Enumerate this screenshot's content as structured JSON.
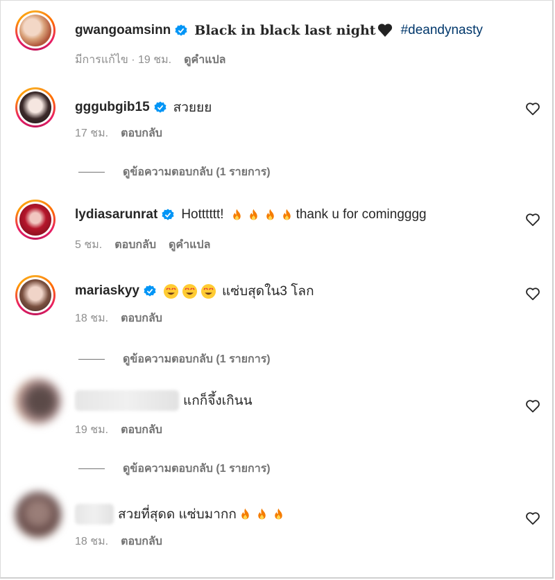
{
  "caption": {
    "username": "gwangoamsinn",
    "text": "Black in black last night",
    "hashtag": "#deandynasty",
    "edited": "มีการแก้ไข · 19 ชม.",
    "translate": "ดูคำแปล"
  },
  "comments": [
    {
      "username": "gggubgib15",
      "text": "สวยยย",
      "time": "17 ชม.",
      "reply": "ตอบกลับ",
      "view_replies": "ดูข้อความตอบกลับ (1 รายการ)"
    },
    {
      "username": "lydiasarunrat",
      "text_before": "Hotttttt!",
      "text_after": "thank u for comingggg",
      "time": "5 ชม.",
      "reply": "ตอบกลับ",
      "translate": "ดูคำแปล"
    },
    {
      "username": "mariaskyy",
      "text": "แซ่บสุดใน3 โลก",
      "time": "18 ชม.",
      "reply": "ตอบกลับ",
      "view_replies": "ดูข้อความตอบกลับ (1 รายการ)"
    },
    {
      "text": "แกก็จึ้งเกินน",
      "time": "19 ชม.",
      "reply": "ตอบกลับ",
      "view_replies": "ดูข้อความตอบกลับ (1 รายการ)"
    },
    {
      "text": "สวยที่สุดด แซ่บมากก",
      "time": "18 ชม.",
      "reply": "ตอบกลับ"
    }
  ],
  "colors": {
    "verified": "#0095f6",
    "hashtag": "#00376b",
    "meta": "#8e8e8e"
  },
  "icons": [
    "verified-badge-icon",
    "heart-icon",
    "fire-emoji",
    "heart-eyes-emoji",
    "black-heart-emoji"
  ]
}
